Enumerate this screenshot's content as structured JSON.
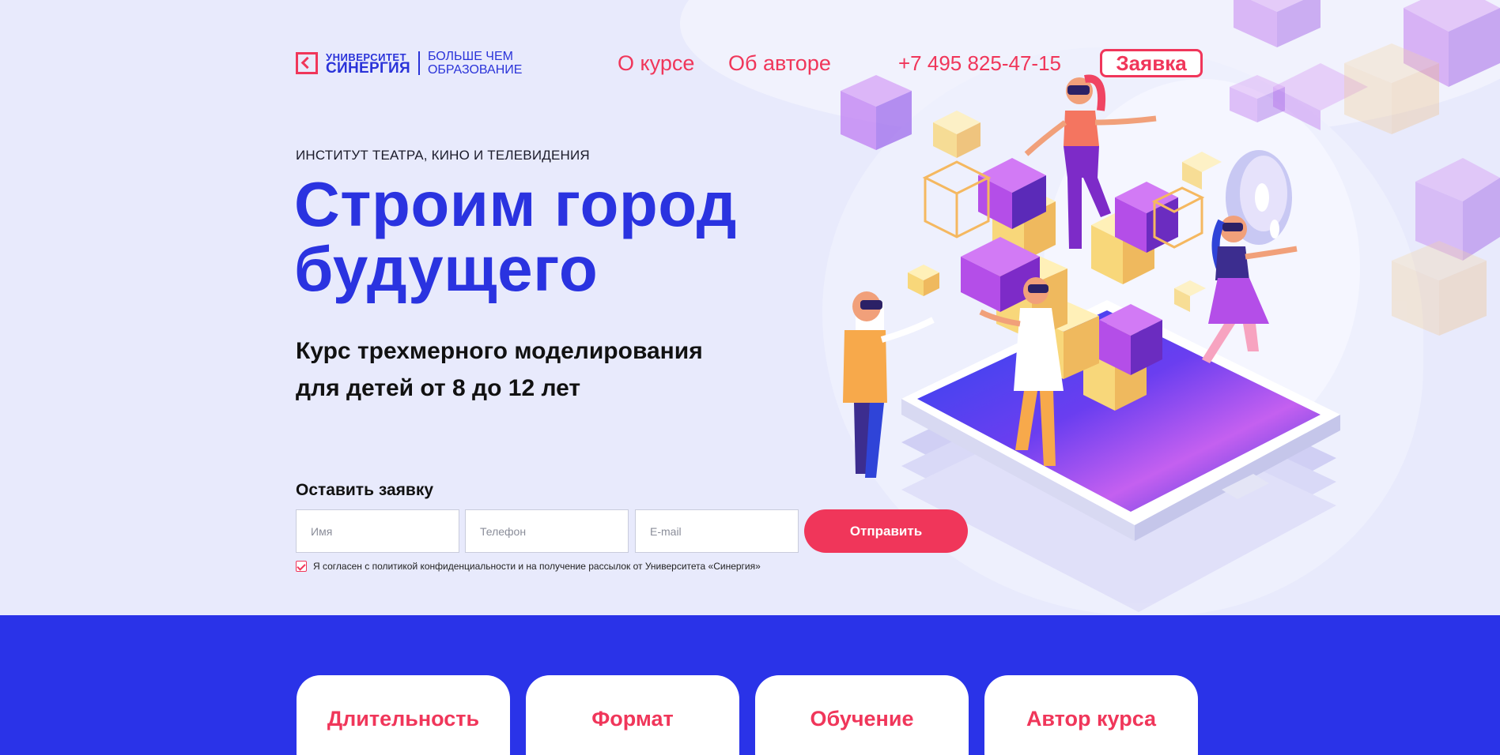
{
  "header": {
    "logo_small": "УНИВЕРСИТЕТ",
    "logo_big": "СИНЕРГИЯ",
    "slogan_line1": "БОЛЬШЕ ЧЕМ",
    "slogan_line2": "ОБРАЗОВАНИЕ",
    "nav": [
      {
        "label": "О курсе"
      },
      {
        "label": "Об авторе"
      }
    ],
    "phone": "+7 495 825-47-15",
    "apply_label": "Заявка"
  },
  "hero": {
    "institute": "ИНСТИТУТ ТЕАТРА, КИНО И ТЕЛЕВИДЕНИЯ",
    "title_line1": "Строим город",
    "title_line2": "будущего",
    "subtitle_line1": "Курс трехмерного моделирования",
    "subtitle_line2": "для детей от 8 до 12 лет"
  },
  "form": {
    "label": "Оставить заявку",
    "name_placeholder": "Имя",
    "phone_placeholder": "Телефон",
    "email_placeholder": "E-mail",
    "submit_label": "Отправить",
    "consent_text": "Я согласен с политикой конфиденциальности и на получение рассылок от Университета «Синергия»",
    "consent_checked": true
  },
  "cards": [
    {
      "title": "Длительность",
      "value": ""
    },
    {
      "title": "Формат",
      "value": ""
    },
    {
      "title": "Обучение",
      "value": ""
    },
    {
      "title": "Автор курса",
      "value": ""
    }
  ],
  "colors": {
    "accent": "#f0365a",
    "brand_blue": "#2a33e0",
    "hero_bg": "#e8eafc",
    "section_blue": "#2a33e8"
  }
}
